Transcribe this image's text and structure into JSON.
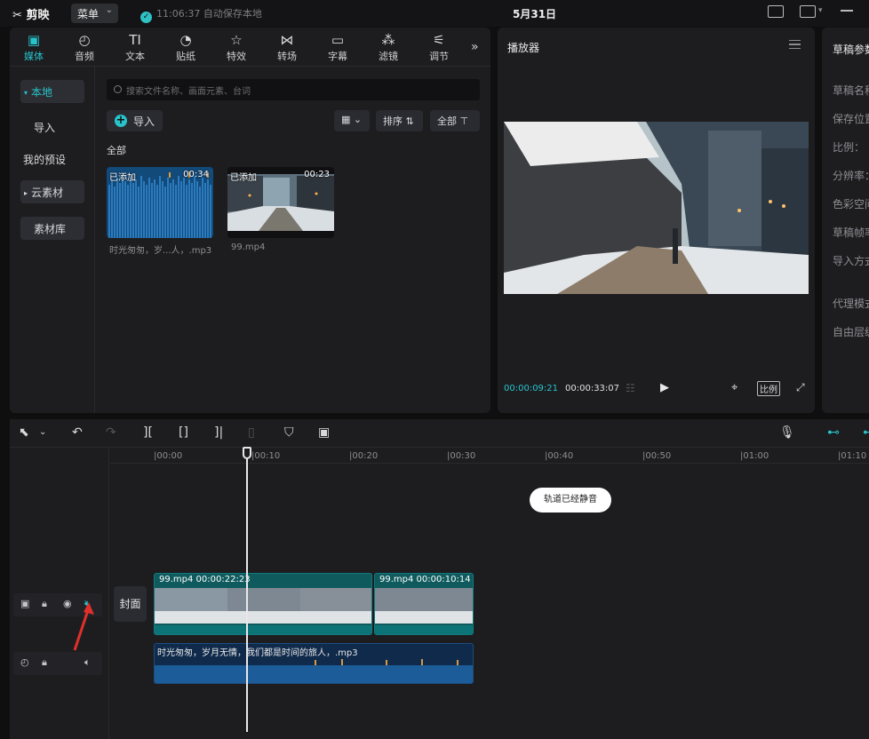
{
  "app": {
    "logo": "剪映",
    "menu_label": "菜单",
    "save_status": "11:06:37 自动保存本地",
    "project_title": "5月31日"
  },
  "media_tabs": [
    {
      "label": "媒体",
      "icon": "media-icon"
    },
    {
      "label": "音频",
      "icon": "audio-icon"
    },
    {
      "label": "文本",
      "icon": "text-icon"
    },
    {
      "label": "贴纸",
      "icon": "sticker-icon"
    },
    {
      "label": "特效",
      "icon": "effects-icon"
    },
    {
      "label": "转场",
      "icon": "transition-icon"
    },
    {
      "label": "字幕",
      "icon": "subtitle-icon"
    },
    {
      "label": "滤镜",
      "icon": "filter-icon"
    },
    {
      "label": "调节",
      "icon": "adjust-icon"
    }
  ],
  "media_sidebar": {
    "local": "本地",
    "import": "导入",
    "my_presets": "我的预设",
    "cloud": "云素材",
    "library": "素材库"
  },
  "media": {
    "search_placeholder": "搜索文件名称、画面元素、台词",
    "import_label": "导入",
    "sort_label": "排序",
    "filter_label": "全部",
    "section_label": "全部",
    "items": [
      {
        "tag": "已添加",
        "duration": "00:34",
        "name": "时光匆匆，岁...人，.mp3"
      },
      {
        "tag": "已添加",
        "duration": "00:23",
        "name": "99.mp4"
      }
    ]
  },
  "player": {
    "title": "播放器",
    "current_time": "00:00:09:21",
    "total_time": "00:00:33:07",
    "ratio_label": "比例"
  },
  "draft_params": {
    "title": "草稿参数",
    "rows": [
      "草稿名称",
      "保存位置",
      "比例：",
      "分辨率：",
      "色彩空间",
      "草稿帧率",
      "导入方式",
      "代理模式",
      "自由层级"
    ]
  },
  "timeline": {
    "ruler_labels": [
      "|00:00",
      "|00:10",
      "|00:20",
      "|00:30",
      "|00:40",
      "|00:50",
      "|01:00",
      "|01:10"
    ],
    "toast": "轨道已经静音",
    "cover_label": "封面",
    "video_clips": [
      {
        "name": "99.mp4",
        "duration": "00:00:22:23"
      },
      {
        "name": "99.mp4",
        "duration": "00:00:10:14"
      }
    ],
    "audio_clip": {
      "name": "时光匆匆，岁月无情，我们都是时间的旅人，.mp3"
    }
  },
  "colors": {
    "accent": "#27c4cc",
    "video_clip": "#0e5a5d",
    "audio_clip": "#0f2a4a",
    "annotation_arrow": "#e0302a"
  }
}
